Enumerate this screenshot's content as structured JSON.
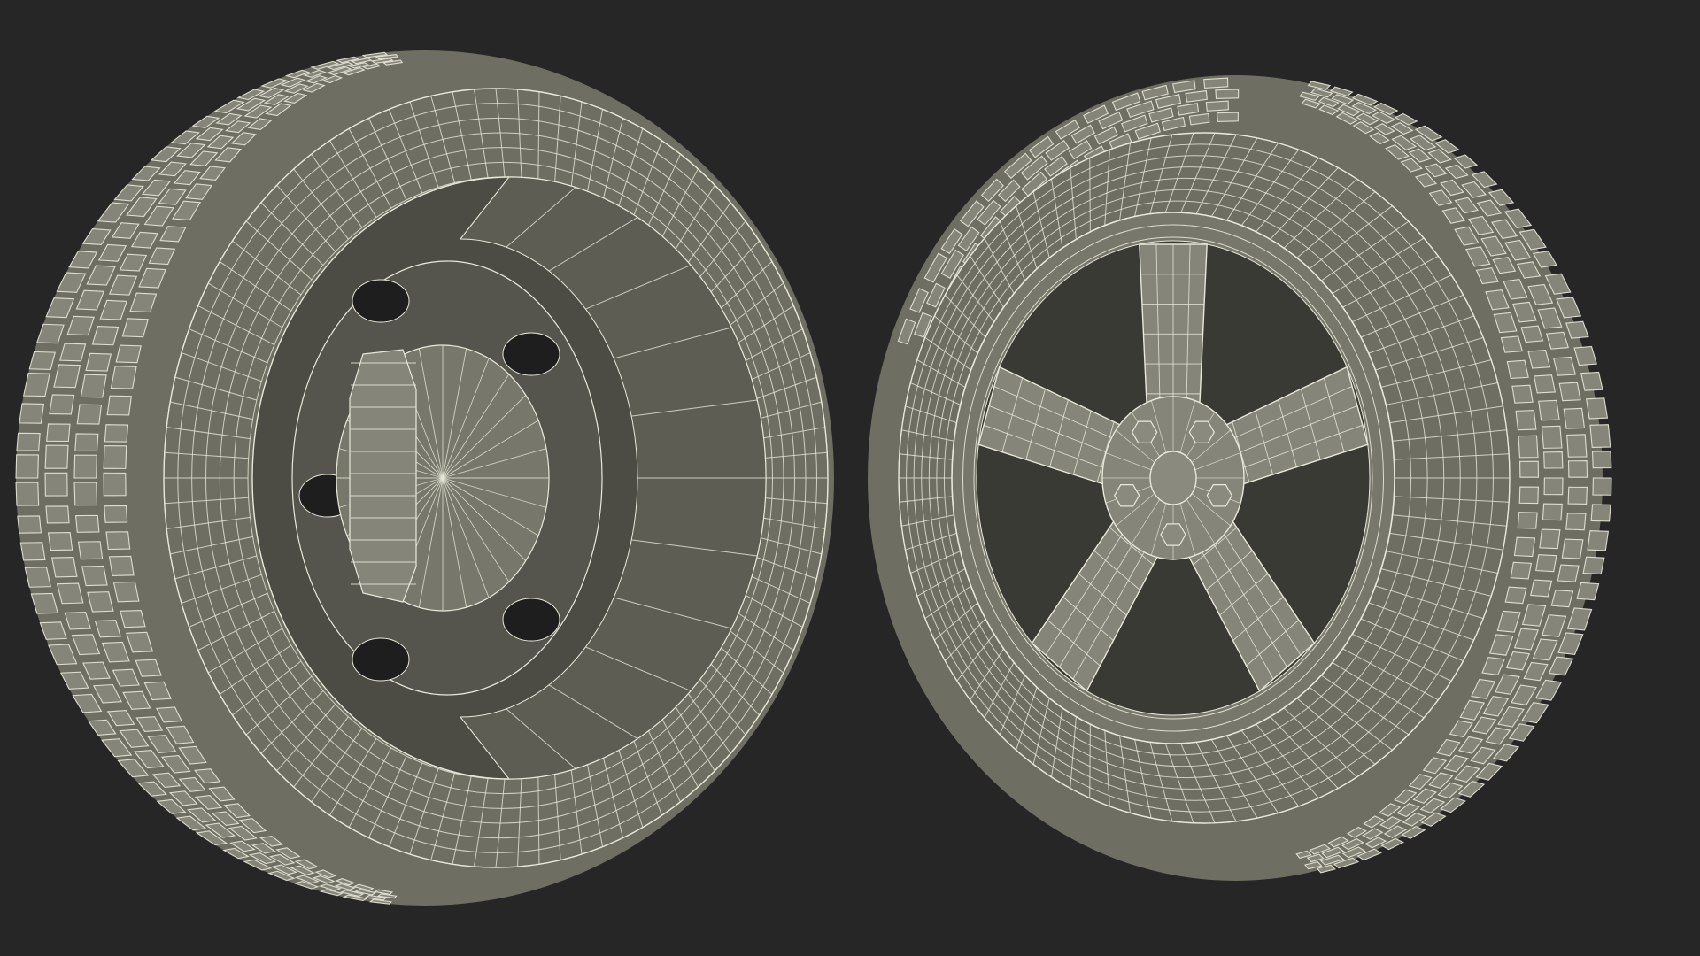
{
  "scene": {
    "background_color": "#262626",
    "mesh_fill_color": "#6e6e63",
    "mesh_fill_light": "#85857a",
    "mesh_fill_dark": "#4c4c44",
    "wire_color": "#e9e9da",
    "objects": [
      {
        "name": "wheel-back-view",
        "description_icon": "wheel-inner-icon"
      },
      {
        "name": "wheel-front-view",
        "description_icon": "wheel-rim-icon"
      }
    ],
    "rim_spoke_count": 5,
    "lug_nut_count": 5
  }
}
